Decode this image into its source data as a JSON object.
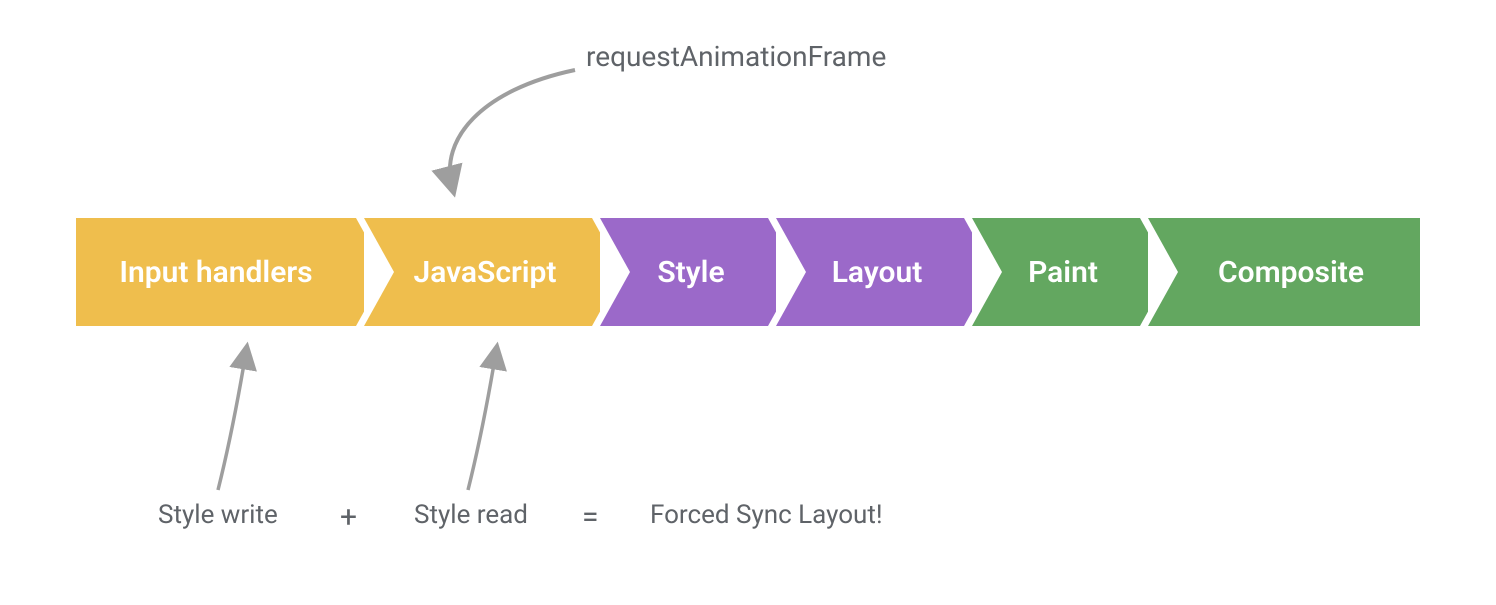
{
  "top_label": "requestAnimationFrame",
  "pipeline": {
    "stages": [
      {
        "label": "Input handlers",
        "color": "yellow"
      },
      {
        "label": "JavaScript",
        "color": "yellow"
      },
      {
        "label": "Style",
        "color": "purple"
      },
      {
        "label": "Layout",
        "color": "purple"
      },
      {
        "label": "Paint",
        "color": "green"
      },
      {
        "label": "Composite",
        "color": "green"
      }
    ]
  },
  "equation": {
    "left": "Style write",
    "plus": "+",
    "right": "Style read",
    "eq": "=",
    "result": "Forced Sync Layout!"
  },
  "colors": {
    "yellow": "#efbe4d",
    "purple": "#9b69c9",
    "green": "#63a760",
    "arrow": "#9e9e9e",
    "text": "#5f6368"
  }
}
